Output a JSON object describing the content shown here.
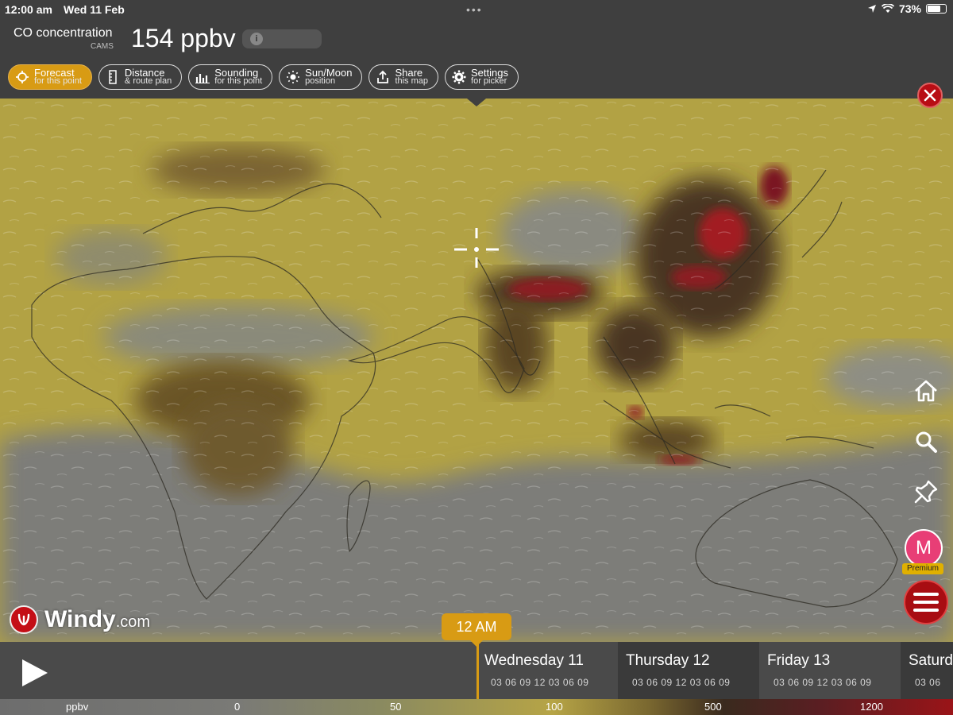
{
  "status": {
    "time": "12:00 am",
    "date": "Wed 11 Feb",
    "battery": "73%",
    "battery_level": 0.73
  },
  "header": {
    "title": "CO concentration",
    "source": "CAMS",
    "value": "154 ppbv",
    "info_glyph": "i"
  },
  "toolbar": [
    {
      "line1": "Forecast",
      "line2": "for this point",
      "icon": "crosshair-icon",
      "active": true
    },
    {
      "line1": "Distance",
      "line2": "& route plan",
      "icon": "ruler-icon",
      "active": false
    },
    {
      "line1": "Sounding",
      "line2": "for this point",
      "icon": "bar-chart-icon",
      "active": false
    },
    {
      "line1": "Sun/Moon",
      "line2": "position",
      "icon": "sun-icon",
      "active": false
    },
    {
      "line1": "Share",
      "line2": "this map",
      "icon": "share-icon",
      "active": false
    },
    {
      "line1": "Settings",
      "line2": "for picker",
      "icon": "gear-icon",
      "active": false
    }
  ],
  "side": {
    "avatar_letter": "M",
    "premium_label": "Premium"
  },
  "logo": {
    "name": "Windy",
    "domain": ".com"
  },
  "timeline": {
    "current_time": "12 AM",
    "days": [
      {
        "name": "Wednesday 11",
        "hours": "03 06 09 12 03 06 09"
      },
      {
        "name": "Thursday 12",
        "hours": "03 06 09 12 03 06 09"
      },
      {
        "name": "Friday 13",
        "hours": "03 06 09 12 03 06 09"
      },
      {
        "name": "Saturday",
        "hours": "03 06"
      }
    ]
  },
  "legend": {
    "unit": "ppbv",
    "ticks": [
      "0",
      "50",
      "100",
      "500",
      "1200"
    ]
  },
  "colors": {
    "accent": "#d89b14",
    "alert_red": "#b80d15",
    "premium": "#e0b000",
    "avatar": "#e83e76",
    "map_yellow": "#b7a53f",
    "map_grey": "#7d7d79",
    "map_dark": "#4a3520",
    "map_red": "#9a1a22"
  }
}
